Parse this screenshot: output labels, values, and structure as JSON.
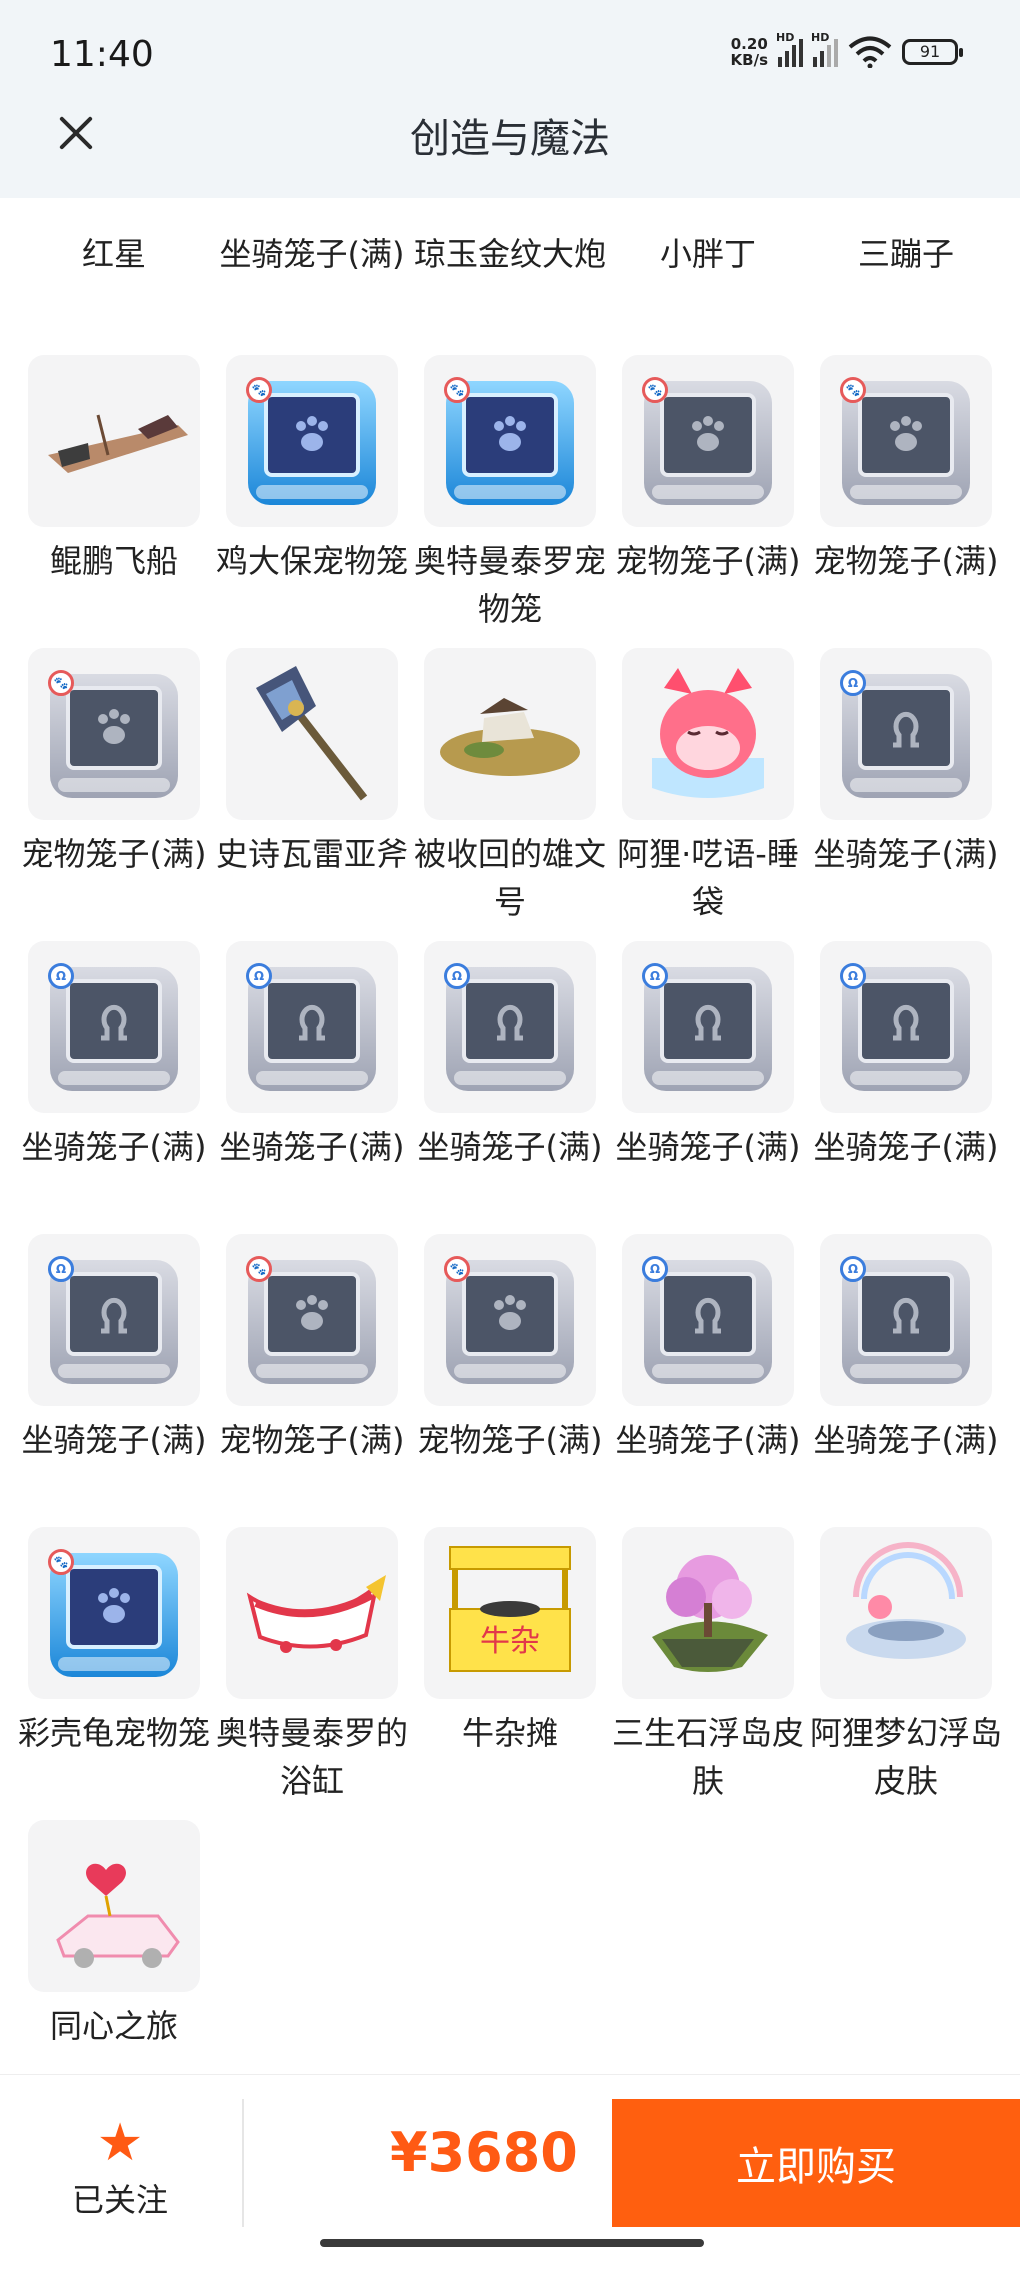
{
  "status_bar": {
    "time": "11:40",
    "net_speed_value": "0.20",
    "net_speed_unit": "KB/s",
    "signal_label": "HD",
    "battery": "91"
  },
  "header": {
    "title": "创造与魔法"
  },
  "items": [
    {
      "label": "红星",
      "icon": "partial-item"
    },
    {
      "label": "坐骑笼子(满)",
      "icon": "partial-item"
    },
    {
      "label": "琼玉金纹大炮",
      "icon": "partial-item"
    },
    {
      "label": "小胖丁",
      "icon": "partial-item"
    },
    {
      "label": "三蹦子",
      "icon": "partial-item"
    },
    {
      "label": "鲲鹏飞船",
      "icon": "airship"
    },
    {
      "label": "鸡大保宠物笼",
      "icon": "pet-cage-blue"
    },
    {
      "label": "奥特曼泰罗宠物笼",
      "icon": "pet-cage-blue"
    },
    {
      "label": "宠物笼子(满)",
      "icon": "pet-cage"
    },
    {
      "label": "宠物笼子(满)",
      "icon": "pet-cage"
    },
    {
      "label": "宠物笼子(满)",
      "icon": "pet-cage"
    },
    {
      "label": "史诗瓦雷亚斧",
      "icon": "axe"
    },
    {
      "label": "被收回的雄文号",
      "icon": "ship-wreck"
    },
    {
      "label": "阿狸·呓语-睡袋",
      "icon": "fox-sleeping-bag"
    },
    {
      "label": "坐骑笼子(满)",
      "icon": "mount-cage"
    },
    {
      "label": "坐骑笼子(满)",
      "icon": "mount-cage"
    },
    {
      "label": "坐骑笼子(满)",
      "icon": "mount-cage"
    },
    {
      "label": "坐骑笼子(满)",
      "icon": "mount-cage"
    },
    {
      "label": "坐骑笼子(满)",
      "icon": "mount-cage"
    },
    {
      "label": "坐骑笼子(满)",
      "icon": "mount-cage"
    },
    {
      "label": "坐骑笼子(满)",
      "icon": "mount-cage"
    },
    {
      "label": "宠物笼子(满)",
      "icon": "pet-cage"
    },
    {
      "label": "宠物笼子(满)",
      "icon": "pet-cage"
    },
    {
      "label": "坐骑笼子(满)",
      "icon": "mount-cage"
    },
    {
      "label": "坐骑笼子(满)",
      "icon": "mount-cage"
    },
    {
      "label": "彩壳龟宠物笼",
      "icon": "pet-cage-blue"
    },
    {
      "label": "奥特曼泰罗的浴缸",
      "icon": "bathtub"
    },
    {
      "label": "牛杂摊",
      "icon": "food-stall",
      "sign": "牛杂"
    },
    {
      "label": "三生石浮岛皮肤",
      "icon": "floating-island"
    },
    {
      "label": "阿狸梦幻浮岛皮肤",
      "icon": "dream-island"
    },
    {
      "label": "同心之旅",
      "icon": "heart-car"
    }
  ],
  "bottom_bar": {
    "follow_label": "已关注",
    "price": "¥3680",
    "buy_label": "立即购买"
  },
  "colors": {
    "accent": "#ff5f0f",
    "header_bg": "#f1f5f8",
    "tile_bg": "#f4f4f5"
  }
}
